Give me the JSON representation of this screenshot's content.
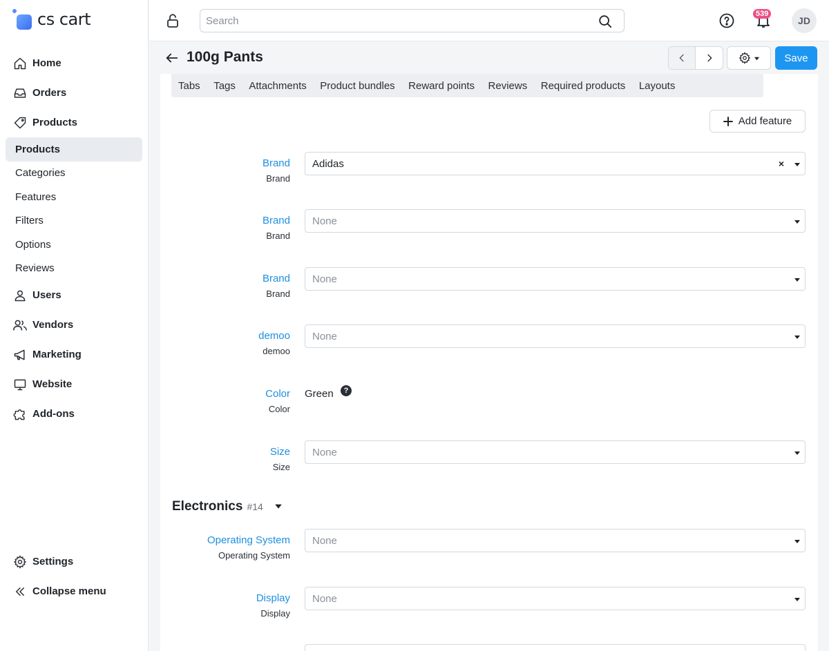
{
  "brand": {
    "name": "cs cart"
  },
  "sidebar": {
    "main_items": [
      {
        "label": "Home",
        "icon": "home-icon"
      },
      {
        "label": "Orders",
        "icon": "inbox-icon"
      },
      {
        "label": "Products",
        "icon": "tag-icon"
      }
    ],
    "products_sub": [
      {
        "label": "Products",
        "active": true
      },
      {
        "label": "Categories"
      },
      {
        "label": "Features"
      },
      {
        "label": "Filters"
      },
      {
        "label": "Options"
      },
      {
        "label": "Reviews"
      }
    ],
    "more_items": [
      {
        "label": "Users",
        "icon": "user-icon"
      },
      {
        "label": "Vendors",
        "icon": "users-icon"
      },
      {
        "label": "Marketing",
        "icon": "megaphone-icon"
      },
      {
        "label": "Website",
        "icon": "monitor-icon"
      },
      {
        "label": "Add-ons",
        "icon": "puzzle-icon"
      }
    ],
    "bottom_items": [
      {
        "label": "Settings",
        "icon": "gear-icon"
      },
      {
        "label": "Collapse menu",
        "icon": "double-chevron-left-icon"
      }
    ]
  },
  "topbar": {
    "search_placeholder": "Search",
    "notifications_count": "539",
    "user_initials": "JD"
  },
  "page": {
    "title": "100g Pants",
    "save_label": "Save",
    "tabs": [
      "Tabs",
      "Tags",
      "Attachments",
      "Product bundles",
      "Reward points",
      "Reviews",
      "Required products",
      "Layouts"
    ],
    "add_feature_label": "Add feature"
  },
  "features": [
    {
      "name": "Brand",
      "desc": "Brand",
      "value": "Adidas",
      "type": "select",
      "filled": true
    },
    {
      "name": "Brand",
      "desc": "Brand",
      "value": "None",
      "type": "select"
    },
    {
      "name": "Brand",
      "desc": "Brand",
      "value": "None",
      "type": "select"
    },
    {
      "name": "demoo",
      "desc": "demoo",
      "value": "None",
      "type": "select"
    },
    {
      "name": "Color",
      "desc": "Color",
      "value": "Green",
      "type": "text"
    },
    {
      "name": "Size",
      "desc": "Size",
      "value": "None",
      "type": "select"
    }
  ],
  "group": {
    "name": "Electronics",
    "id": "#14",
    "features": [
      {
        "name": "Operating System",
        "desc": "Operating System",
        "value": "None"
      },
      {
        "name": "Display",
        "desc": "Display",
        "value": "None"
      }
    ]
  },
  "colors": {
    "accent": "#1d96f2",
    "link": "#1d8fe0",
    "badge": "#ee4f86"
  }
}
